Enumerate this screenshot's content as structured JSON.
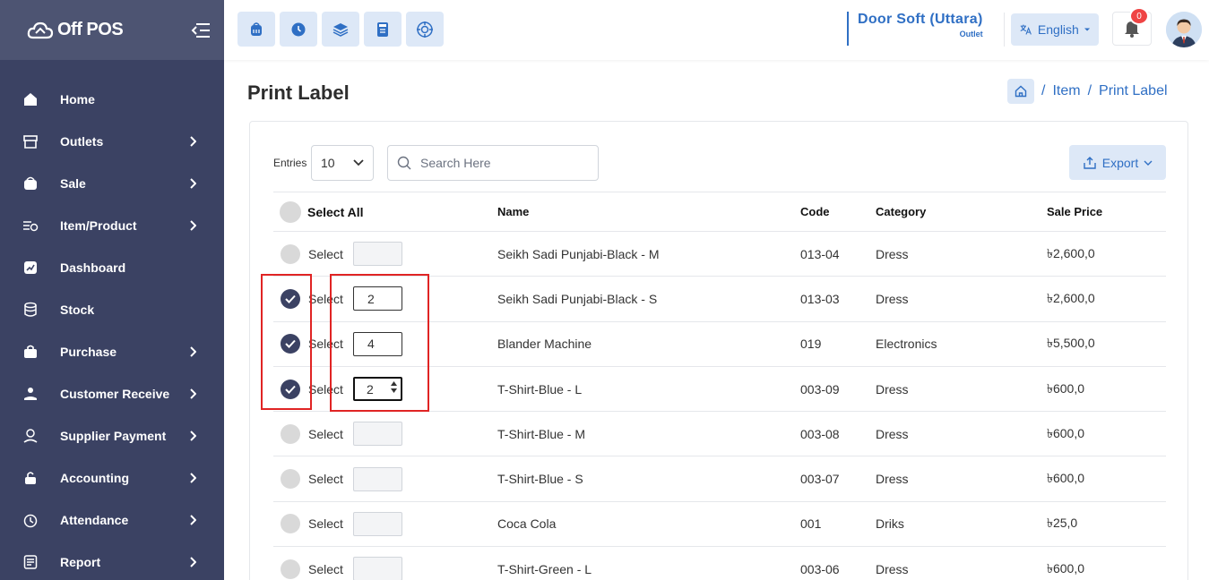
{
  "app": {
    "name": "Off POS"
  },
  "sidebar": {
    "items": [
      {
        "label": "Home",
        "icon": "home-icon",
        "has_children": false
      },
      {
        "label": "Outlets",
        "icon": "store-icon",
        "has_children": true
      },
      {
        "label": "Sale",
        "icon": "basket-icon",
        "has_children": true
      },
      {
        "label": "Item/Product",
        "icon": "item-list-icon",
        "has_children": true
      },
      {
        "label": "Dashboard",
        "icon": "chart-icon",
        "has_children": false
      },
      {
        "label": "Stock",
        "icon": "database-icon",
        "has_children": false
      },
      {
        "label": "Purchase",
        "icon": "bag-icon",
        "has_children": true
      },
      {
        "label": "Customer Receive",
        "icon": "hand-coin-icon",
        "has_children": true
      },
      {
        "label": "Supplier Payment",
        "icon": "wallet-icon",
        "has_children": true
      },
      {
        "label": "Accounting",
        "icon": "lock-icon",
        "has_children": true
      },
      {
        "label": "Attendance",
        "icon": "clock-icon",
        "has_children": true
      },
      {
        "label": "Report",
        "icon": "report-icon",
        "has_children": true
      }
    ]
  },
  "header": {
    "quick_actions": [
      "pos-icon",
      "clock-icon",
      "layers-icon",
      "calculator-icon",
      "target-icon"
    ],
    "outlet": {
      "name": "Door Soft (Uttara)",
      "sub": "Outlet"
    },
    "language": "English",
    "notifications": "0"
  },
  "page": {
    "title": "Print Label",
    "breadcrumb": [
      "/",
      "Item",
      "/",
      "Print Label"
    ]
  },
  "toolbar": {
    "entries_label": "Entries",
    "entries_value": "10",
    "search_placeholder": "Search Here",
    "export_label": "Export"
  },
  "table": {
    "headers": {
      "select_all": "Select All",
      "name": "Name",
      "code": "Code",
      "category": "Category",
      "sale_price": "Sale Price"
    },
    "rows": [
      {
        "selected": false,
        "select_label": "Select",
        "qty": "",
        "name": "Seikh Sadi Punjabi-Black - M",
        "code": "013-04",
        "category": "Dress",
        "price": "৳2,600,0"
      },
      {
        "selected": true,
        "select_label": "Select",
        "qty": "2",
        "name": "Seikh Sadi Punjabi-Black - S",
        "code": "013-03",
        "category": "Dress",
        "price": "৳2,600,0"
      },
      {
        "selected": true,
        "select_label": "Select",
        "qty": "4",
        "name": "Blander Machine",
        "code": "019",
        "category": "Electronics",
        "price": "৳5,500,0"
      },
      {
        "selected": true,
        "select_label": "Select",
        "qty": "2",
        "name": "T-Shirt-Blue - L",
        "code": "003-09",
        "category": "Dress",
        "price": "৳600,0"
      },
      {
        "selected": false,
        "select_label": "Select",
        "qty": "",
        "name": "T-Shirt-Blue - M",
        "code": "003-08",
        "category": "Dress",
        "price": "৳600,0"
      },
      {
        "selected": false,
        "select_label": "Select",
        "qty": "",
        "name": "T-Shirt-Blue - S",
        "code": "003-07",
        "category": "Dress",
        "price": "৳600,0"
      },
      {
        "selected": false,
        "select_label": "Select",
        "qty": "",
        "name": "Coca Cola",
        "code": "001",
        "category": "Driks",
        "price": "৳25,0"
      },
      {
        "selected": false,
        "select_label": "Select",
        "qty": "",
        "name": "T-Shirt-Green - L",
        "code": "003-06",
        "category": "Dress",
        "price": "৳600,0"
      }
    ]
  },
  "colors": {
    "sidebar": "#3b4263",
    "accent": "#2f6fc4",
    "highlight": "#e02424"
  }
}
